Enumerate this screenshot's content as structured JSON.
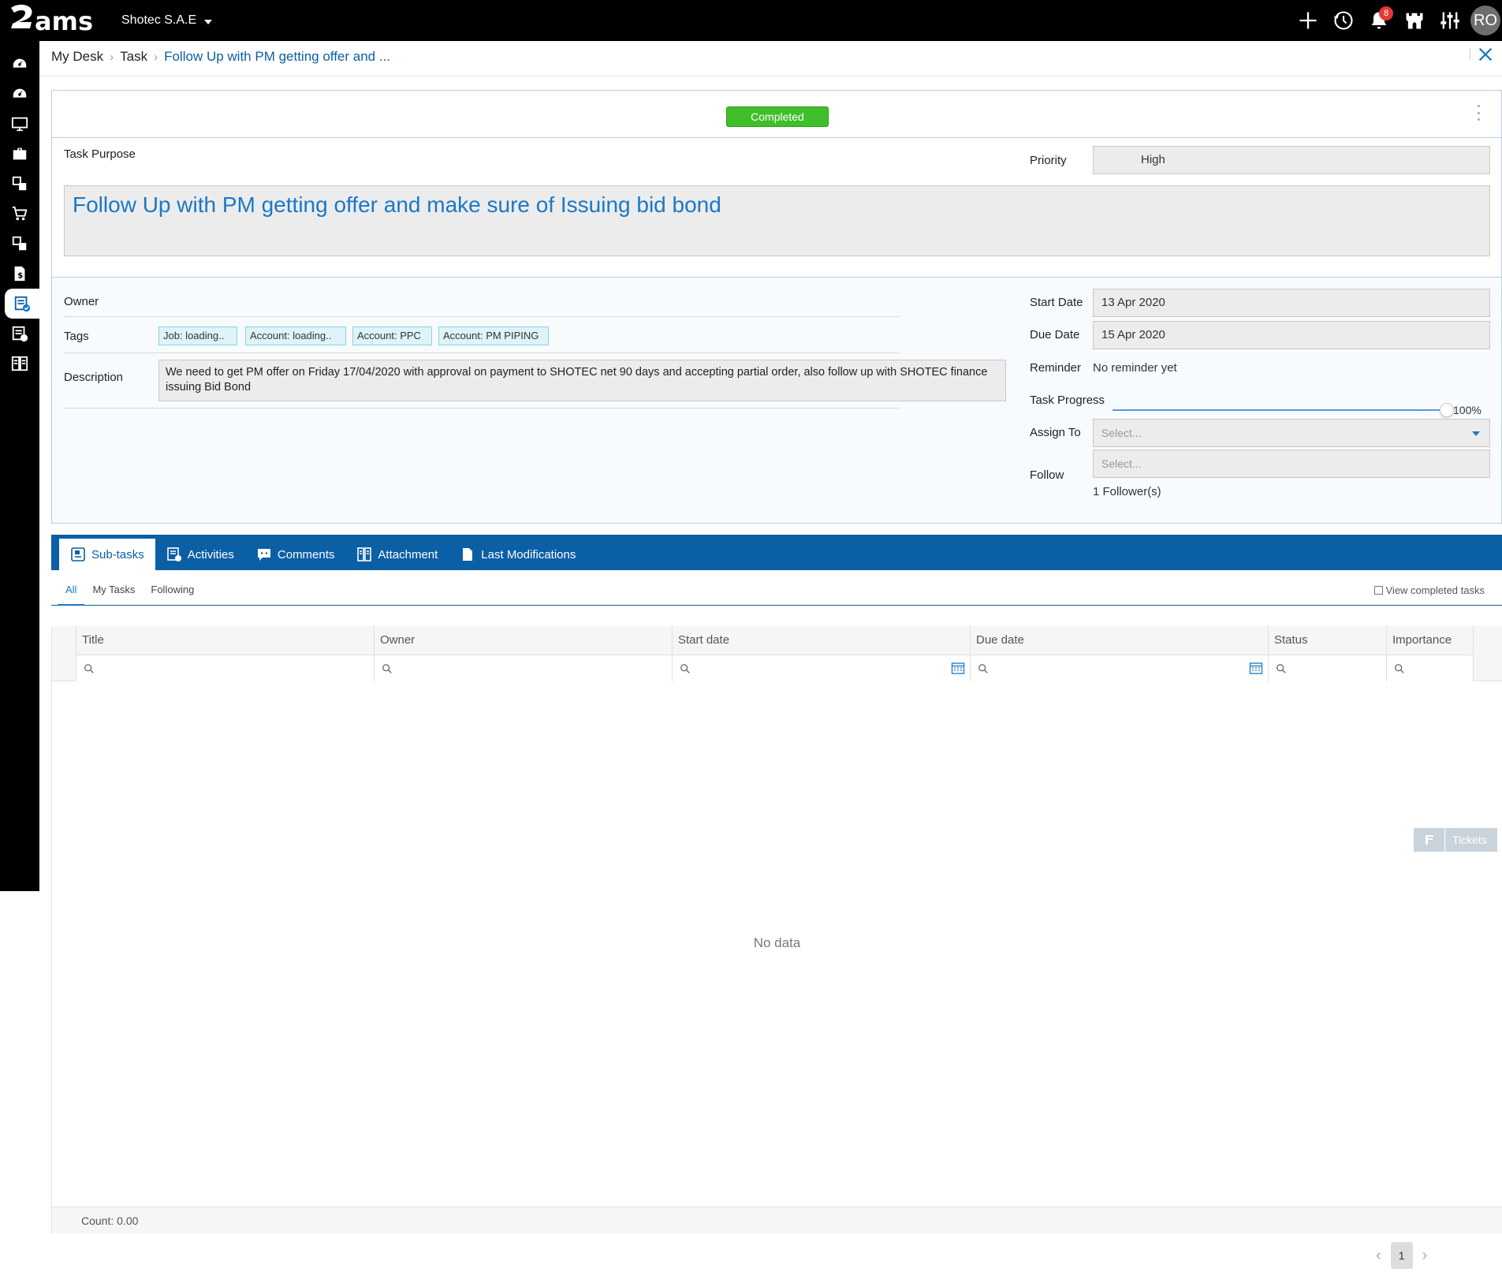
{
  "app": {
    "logo_text": "ams",
    "company": "Shotec S.A.E"
  },
  "topbar": {
    "notifications_count": "8",
    "avatar_initials": "RO"
  },
  "breadcrumb": {
    "items": [
      "My Desk",
      "Task"
    ],
    "current": "Follow Up with PM getting offer and ..."
  },
  "task": {
    "status": "Completed",
    "purpose_label": "Task Purpose",
    "purpose": "Follow Up with PM getting offer and make sure of Issuing bid bond",
    "priority_label": "Priority",
    "priority": "High",
    "owner_label": "Owner",
    "tags_label": "Tags",
    "tags": [
      "Job: loading..",
      "Account: loading..",
      "Account: PPC",
      "Account: PM PIPING"
    ],
    "description_label": "Description",
    "description": "We need to get PM offer on Friday 17/04/2020 with approval on payment to SHOTEC net 90 days and accepting partial order, also follow up with SHOTEC finance issuing Bid Bond",
    "start_date_label": "Start Date",
    "start_date": "13 Apr 2020",
    "due_date_label": "Due Date",
    "due_date": "15 Apr 2020",
    "reminder_label": "Reminder",
    "reminder": "No reminder yet",
    "progress_label": "Task Progress",
    "progress": "100%",
    "progress_fraction": 1.0,
    "assign_label": "Assign To",
    "assign_placeholder": "Select...",
    "follow_label": "Follow",
    "follow_placeholder": "Select...",
    "followers": "1 Follower(s)"
  },
  "tabs": [
    "Sub-tasks",
    "Activities",
    "Comments",
    "Attachment",
    "Last Modifications"
  ],
  "subtabs": [
    "All",
    "My Tasks",
    "Following"
  ],
  "view_completed": "View completed tasks",
  "grid": {
    "columns": [
      "Title",
      "Owner",
      "Start date",
      "Due date",
      "Status",
      "Importance"
    ],
    "empty": "No data",
    "count": "Count: 0.00"
  },
  "tickets_label": "Tickets",
  "pager": {
    "page": "1"
  },
  "colors": {
    "primary": "#0b5fa5",
    "accent": "#1b78c6",
    "completed": "#3fbf2a"
  }
}
